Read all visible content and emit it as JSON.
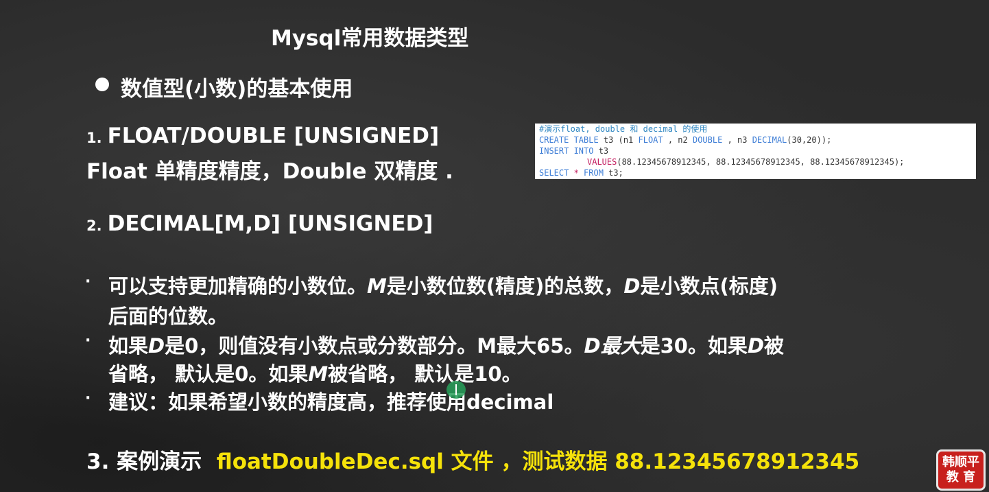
{
  "title": "Mysql常用数据类型",
  "subtitle": "数值型(小数)的基本使用",
  "section1": {
    "num": "1.",
    "heading": "FLOAT/DOUBLE [UNSIGNED]",
    "desc": "Float 单精度精度，Double 双精度 ."
  },
  "section2": {
    "num": "2.",
    "heading": "DECIMAL[M,D] [UNSIGNED]"
  },
  "points": {
    "p1_a": "可以支持更加精确的小数位。",
    "p1_m": "M",
    "p1_b": "是小数位数(精度)的总数，",
    "p1_d": "D",
    "p1_c": "是小数点(标度)",
    "p1_line2": "后面的位数。",
    "p2_a": "如果",
    "p2_d1": "D",
    "p2_b": "是0，则值没有小数点或分数部分。M最大65。",
    "p2_d2": "D最大",
    "p2_c": "是30。如果",
    "p2_d3": "D",
    "p2_e": "被",
    "p2_line2a": "省略， 默认是0。如果",
    "p2_m": "M",
    "p2_line2b": "被省略， 默认是10。",
    "p3": "建议：如果希望小数的精度高，推荐使用decimal"
  },
  "case": {
    "prefix": "3. 案例演示",
    "highlight": "floatDoubleDec.sql 文件 ，测试数据 88.12345678912345"
  },
  "code_lines": {
    "l1": "#演示float, double 和 decimal 的使用",
    "l2a": "CREATE TABLE",
    "l2b": " t3 (n1 ",
    "l2c": "FLOAT",
    "l2d": " , n2 ",
    "l2e": "DOUBLE",
    "l2f": " , n3 ",
    "l2g": "DECIMAL",
    "l2h": "(30,20));",
    "l3a": "INSERT INTO",
    "l3b": " t3",
    "l4a": "VALUES",
    "l4b": "(88.12345678912345, 88.12345678912345, 88.12345678912345);",
    "l5a": "SELECT",
    "l5b": " * ",
    "l5c": "FROM",
    "l5d": " t3;"
  },
  "logo": {
    "line1": "韩顺平",
    "line2": "教 育"
  }
}
